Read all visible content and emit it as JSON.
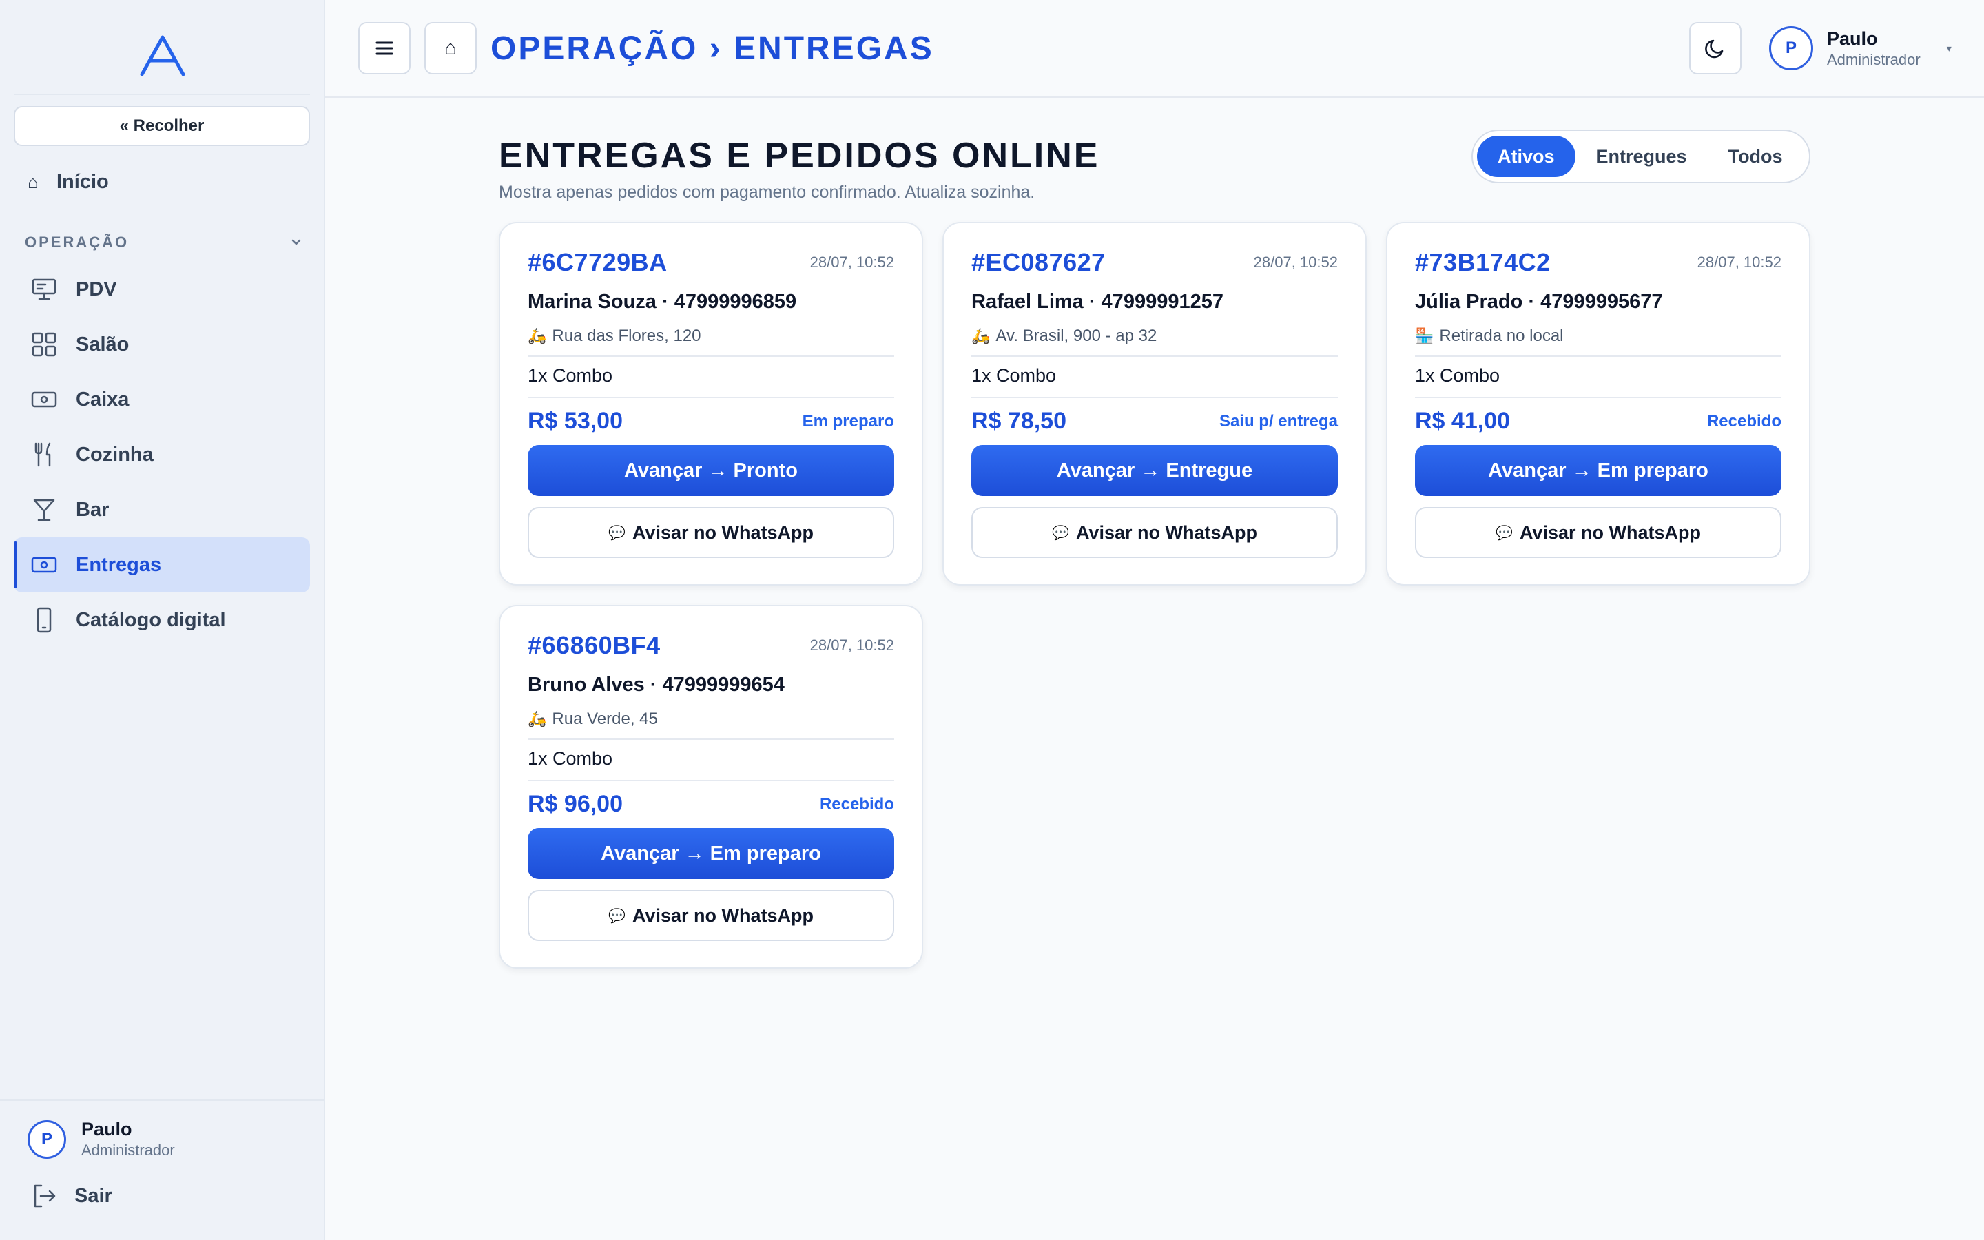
{
  "sidebar": {
    "collapse_label": "« Recolher",
    "home_label": "Início",
    "section_label": "OPERAÇÃO",
    "items": [
      {
        "label": "PDV",
        "icon": "monitor-icon"
      },
      {
        "label": "Salão",
        "icon": "grid-icon"
      },
      {
        "label": "Caixa",
        "icon": "cash-icon"
      },
      {
        "label": "Cozinha",
        "icon": "utensils-icon"
      },
      {
        "label": "Bar",
        "icon": "cocktail-glass-icon"
      },
      {
        "label": "Entregas",
        "icon": "cash-icon",
        "active": true
      },
      {
        "label": "Catálogo digital",
        "icon": "phone-icon"
      }
    ],
    "user": {
      "initial": "P",
      "name": "Paulo",
      "role": "Administrador"
    },
    "logout_label": "Sair"
  },
  "header": {
    "breadcrumb": "OPERAÇÃO › ENTREGAS",
    "user": {
      "initial": "P",
      "name": "Paulo",
      "role": "Administrador"
    }
  },
  "main": {
    "title": "ENTREGAS E PEDIDOS ONLINE",
    "subtitle": "Mostra apenas pedidos com pagamento confirmado. Atualiza sozinha.",
    "filters": [
      "Ativos",
      "Entregues",
      "Todos"
    ],
    "active_filter": "Ativos",
    "whatsapp_label": "Avisar no WhatsApp",
    "orders": [
      {
        "id": "#6C7729BA",
        "time": "28/07, 10:52",
        "customer": "Marina Souza · 47999996859",
        "address_icon": "🛵",
        "address": "Rua das Flores, 120",
        "items": "1x Combo",
        "price": "R$ 53,00",
        "status": "Em preparo",
        "action": "Avançar → Pronto"
      },
      {
        "id": "#EC087627",
        "time": "28/07, 10:52",
        "customer": "Rafael Lima · 47999991257",
        "address_icon": "🛵",
        "address": "Av. Brasil, 900 - ap 32",
        "items": "1x Combo",
        "price": "R$ 78,50",
        "status": "Saiu p/ entrega",
        "action": "Avançar → Entregue"
      },
      {
        "id": "#73B174C2",
        "time": "28/07, 10:52",
        "customer": "Júlia Prado · 47999995677",
        "address_icon": "🏪",
        "address": "Retirada no local",
        "items": "1x Combo",
        "price": "R$ 41,00",
        "status": "Recebido",
        "action": "Avançar → Em preparo"
      },
      {
        "id": "#66860BF4",
        "time": "28/07, 10:52",
        "customer": "Bruno Alves · 47999999654",
        "address_icon": "🛵",
        "address": "Rua Verde, 45",
        "items": "1x Combo",
        "price": "R$ 96,00",
        "status": "Recebido",
        "action": "Avançar → Em preparo"
      }
    ]
  },
  "colors": {
    "accent": "#1d4ed8",
    "accent_btn": "#2563eb",
    "sidebar_bg": "#eef2f8",
    "active_nav_bg": "#d3e0fa"
  }
}
